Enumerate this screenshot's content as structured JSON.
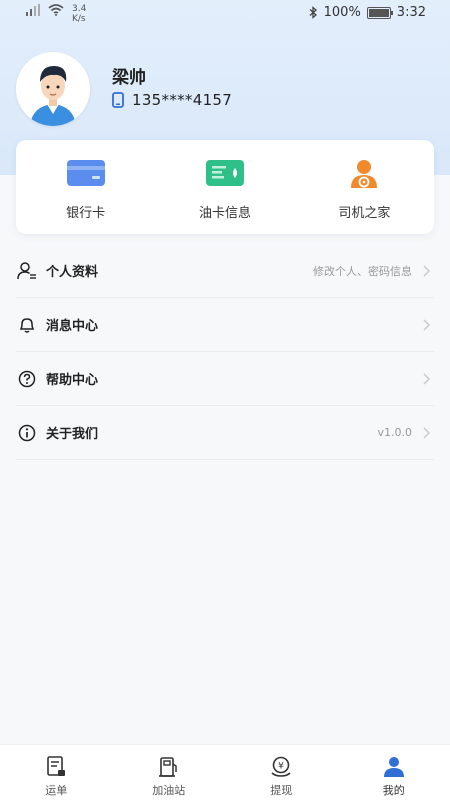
{
  "status_bar": {
    "speed_value": "3.4",
    "speed_unit": "K/s",
    "battery": "100%",
    "time": "3:32"
  },
  "profile": {
    "name": "梁帅",
    "phone": "135****4157"
  },
  "quick_actions": [
    {
      "label": "银行卡",
      "icon": "bank-card-icon",
      "color": "#5b8def"
    },
    {
      "label": "油卡信息",
      "icon": "fuel-card-icon",
      "color": "#2fc08a"
    },
    {
      "label": "司机之家",
      "icon": "driver-home-icon",
      "color": "#f08a2c"
    }
  ],
  "menu": [
    {
      "label": "个人资料",
      "hint": "修改个人、密码信息",
      "icon": "user-profile-icon"
    },
    {
      "label": "消息中心",
      "hint": "",
      "icon": "bell-icon"
    },
    {
      "label": "帮助中心",
      "hint": "",
      "icon": "question-icon"
    },
    {
      "label": "关于我们",
      "hint": "v1.0.0",
      "icon": "info-icon"
    }
  ],
  "tabs": [
    {
      "label": "运单",
      "icon": "waybill-icon",
      "active": false
    },
    {
      "label": "加油站",
      "icon": "gas-station-icon",
      "active": false
    },
    {
      "label": "提现",
      "icon": "withdraw-icon",
      "active": false
    },
    {
      "label": "我的",
      "icon": "me-icon",
      "active": true
    }
  ],
  "colors": {
    "header_bg": "#e3eefb",
    "accent_blue": "#2f6fd6"
  }
}
